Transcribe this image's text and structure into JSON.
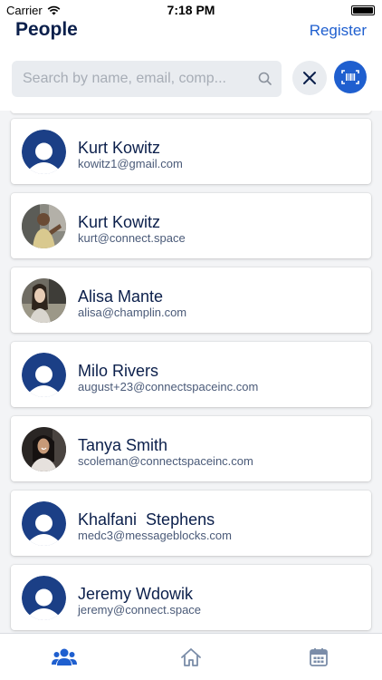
{
  "status_bar": {
    "carrier": "Carrier",
    "time": "7:18 PM"
  },
  "header": {
    "title": "People",
    "register_label": "Register"
  },
  "search": {
    "placeholder": "Search by name, email, comp...",
    "value": ""
  },
  "people": [
    {
      "name": "Kurt Kowitz",
      "email": "kowitz1@gmail.com",
      "avatar": "default-avatar"
    },
    {
      "name": "Kurt Kowitz",
      "email": "kurt@connect.space",
      "avatar": "photo"
    },
    {
      "name": "Alisa Mante",
      "email": "alisa@champlin.com",
      "avatar": "photo"
    },
    {
      "name": "Milo Rivers",
      "email": "august+23@connectspaceinc.com",
      "avatar": "default-avatar"
    },
    {
      "name": "Tanya Smith",
      "email": "scoleman@connectspaceinc.com",
      "avatar": "photo"
    },
    {
      "name": "Khalfani  Stephens",
      "email": "medc3@messageblocks.com",
      "avatar": "default-avatar"
    },
    {
      "name": "Jeremy Wdowik",
      "email": "jeremy@connect.space",
      "avatar": "default-avatar"
    }
  ],
  "tabs": [
    {
      "icon": "people-icon",
      "active": true
    },
    {
      "icon": "home-icon",
      "active": false
    },
    {
      "icon": "calendar-icon",
      "active": false
    }
  ],
  "colors": {
    "accent": "#1f5fcf",
    "navy": "#0b1f4b"
  }
}
